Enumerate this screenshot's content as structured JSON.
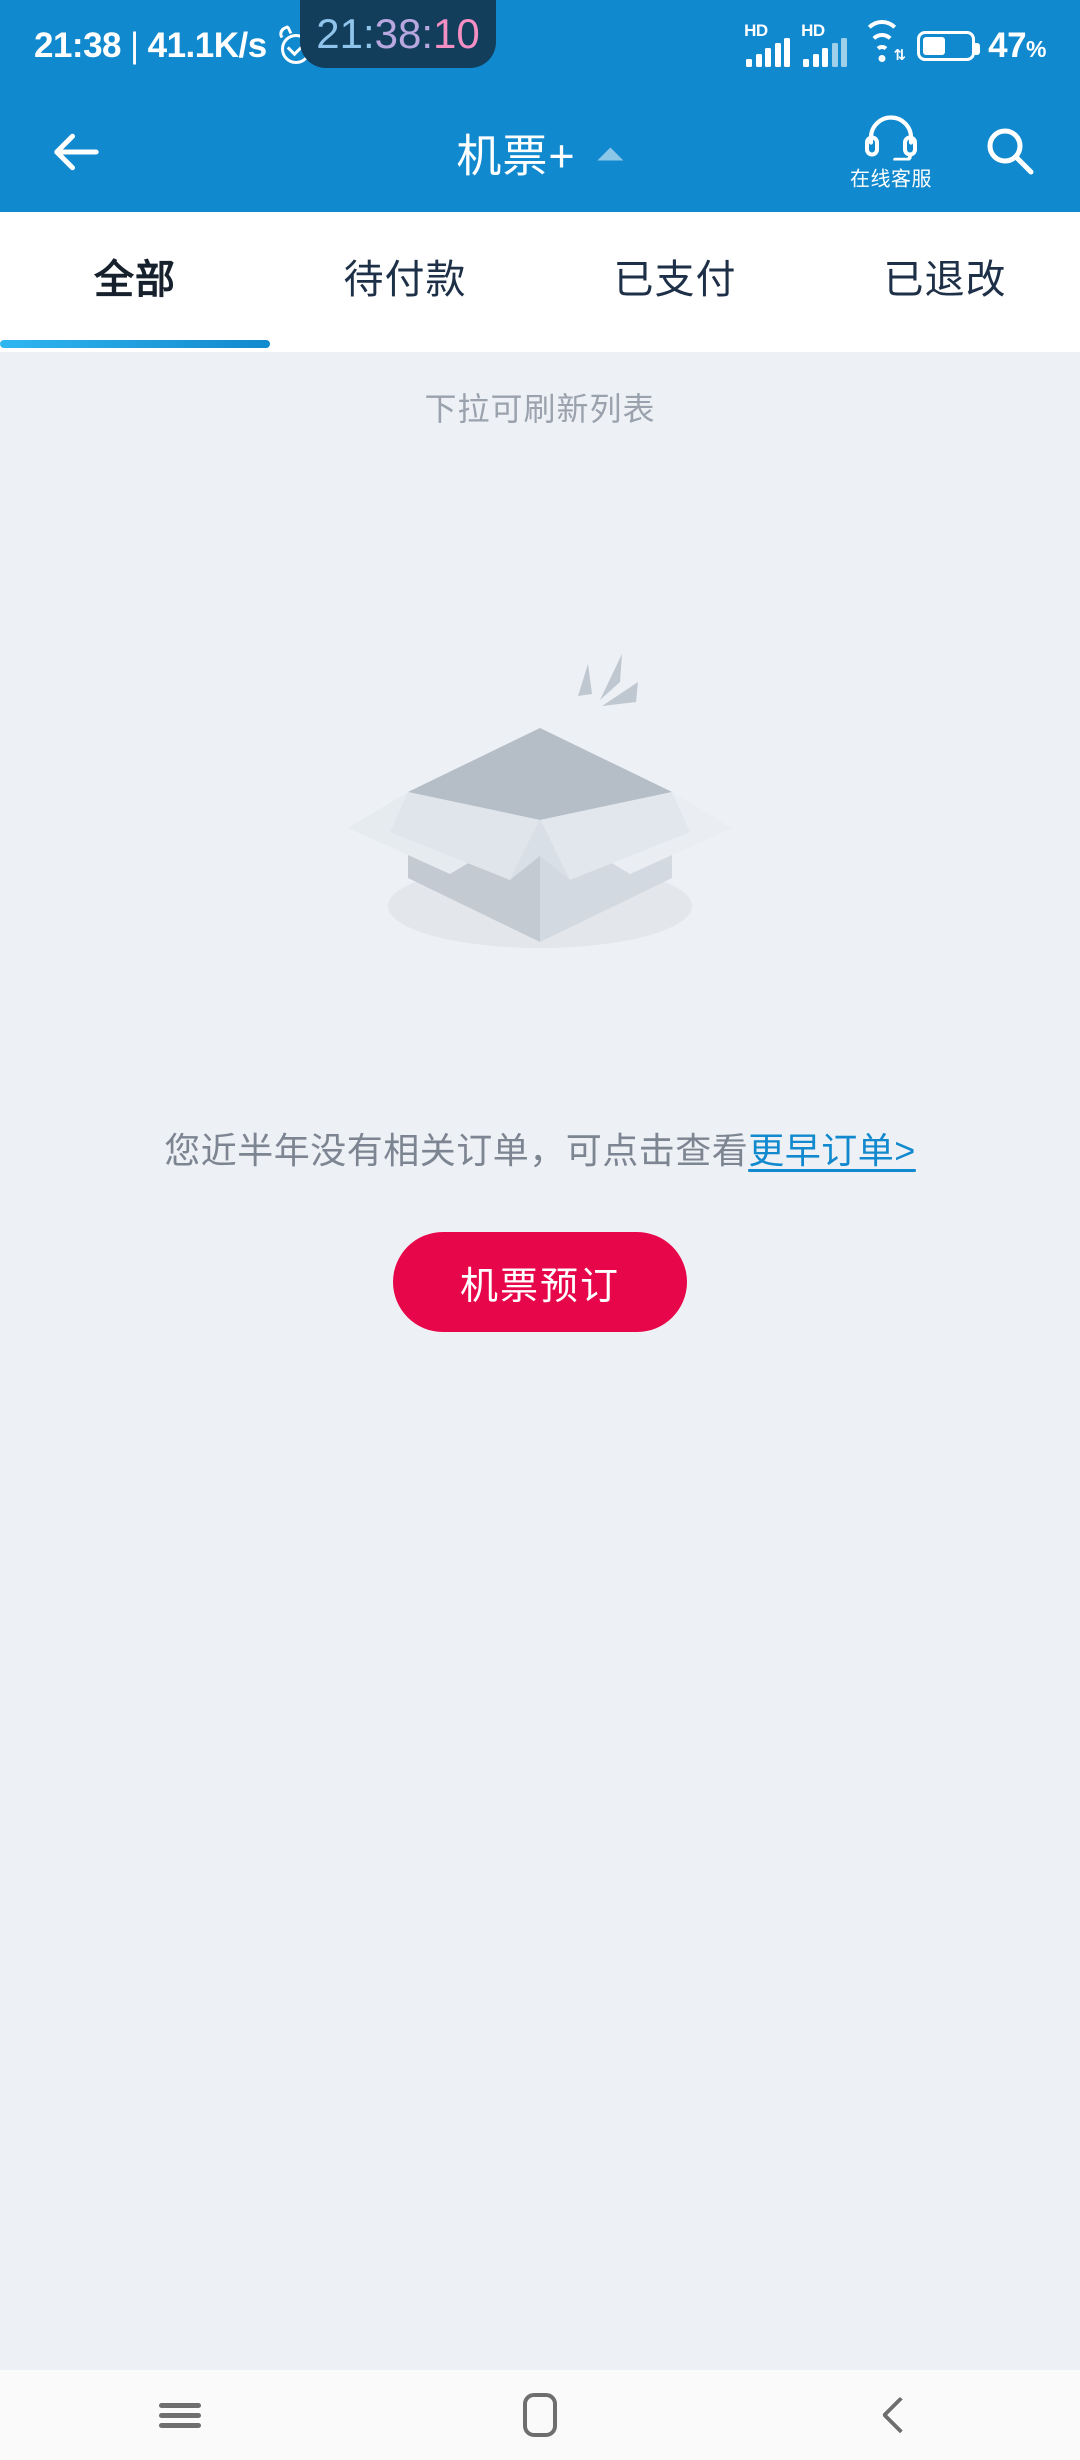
{
  "status_bar": {
    "clock": "21:38",
    "separator": "|",
    "net_speed": "41.1K/s",
    "alarm_icon": "alarm-clock-icon",
    "signal_1_label": "HD",
    "signal_2_label": "HD",
    "wifi_icon": "wifi-icon",
    "wifi_data_glyph": "⇅",
    "battery_percent": "47",
    "battery_unit": "%",
    "battery_level": 47
  },
  "floating_time_widget": {
    "part_hours": "21:",
    "part_minutes": "38:",
    "part_seconds": "10",
    "full": "21:38:10",
    "color_hours": "#90C4EA",
    "color_minutes": "#B9A7E0",
    "color_seconds": "#F48FC4",
    "background": "#123E5C"
  },
  "appbar": {
    "back_icon": "back-arrow-icon",
    "title": "机票+",
    "dropdown_icon": "triangle-up-icon",
    "service_icon": "headset-icon",
    "service_label": "在线客服",
    "search_icon": "search-icon",
    "background": "#1189CE"
  },
  "tabs": {
    "items": [
      {
        "label": "全部",
        "active": true
      },
      {
        "label": "待付款",
        "active": false
      },
      {
        "label": "已支付",
        "active": false
      },
      {
        "label": "已退改",
        "active": false
      }
    ],
    "indicator_color": "#1189CE"
  },
  "content": {
    "refresh_hint": "下拉可刷新列表",
    "empty_illustration": "empty-box-illustration",
    "empty_message": "您近半年没有相关订单，可点击查看",
    "empty_link": "更早订单>",
    "link_color": "#1189CE",
    "book_button_label": "机票预订",
    "book_button_color": "#E8064A",
    "background": "#EDF0F4"
  },
  "nav_bar": {
    "recents_icon": "recents-icon",
    "home_icon": "home-icon",
    "back_icon": "back-chevron-icon"
  }
}
